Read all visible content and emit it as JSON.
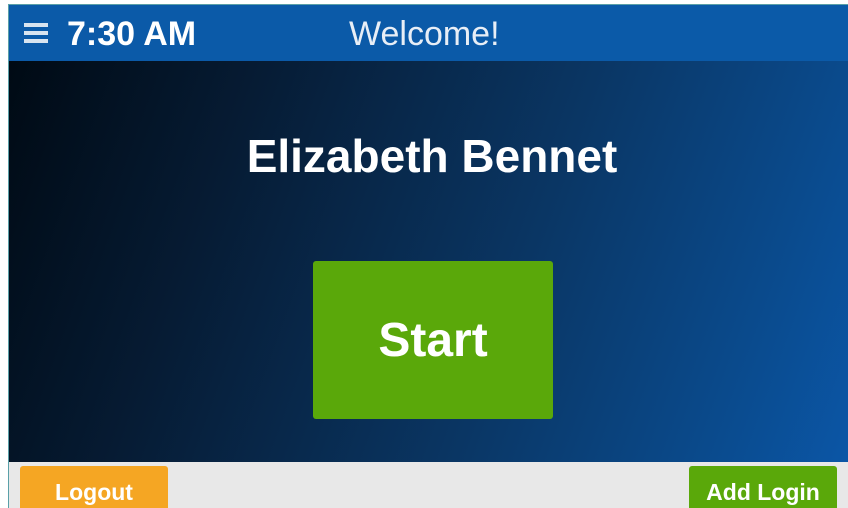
{
  "header": {
    "menu_icon": "hamburger-menu-icon",
    "time": "7:30 AM",
    "title": "Welcome!"
  },
  "main": {
    "user_name": "Elizabeth Bennet",
    "start_label": "Start"
  },
  "footer": {
    "logout_label": "Logout",
    "add_login_label": "Add Login"
  },
  "colors": {
    "header_bg": "#0b5aa8",
    "start_green": "#5aa80a",
    "logout_orange": "#f5a623",
    "footer_bg": "#e8e8e8"
  }
}
